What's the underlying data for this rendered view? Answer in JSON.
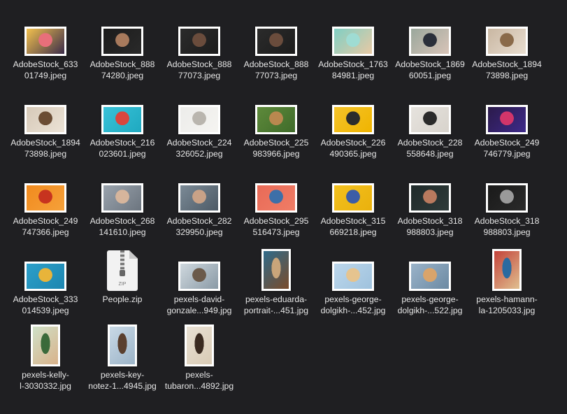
{
  "files": [
    {
      "l1": "AdobeStock_633",
      "l2": "01749.jpeg",
      "o": "land",
      "c": [
        "#f2c14e",
        "#e86f7a",
        "#3b2c4a"
      ]
    },
    {
      "l1": "AdobeStock_888",
      "l2": "74280.jpeg",
      "o": "land",
      "c": [
        "#1b1b1b",
        "#a87a5c",
        "#2a2a2a"
      ]
    },
    {
      "l1": "AdobeStock_888",
      "l2": "77073.jpeg",
      "o": "land",
      "c": [
        "#2b2b2b",
        "#6a4c3c",
        "#1c1c1c"
      ]
    },
    {
      "l1": "AdobeStock_888",
      "l2": "77073.jpeg",
      "o": "land",
      "c": [
        "#2b2b2b",
        "#6a4c3c",
        "#1c1c1c"
      ]
    },
    {
      "l1": "AdobeStock_1763",
      "l2": "84981.jpeg",
      "o": "land",
      "c": [
        "#7fcfc4",
        "#9fdcd3",
        "#e8c9a4"
      ]
    },
    {
      "l1": "AdobeStock_1869",
      "l2": "60051.jpeg",
      "o": "land",
      "c": [
        "#9aa79c",
        "#2a2f3a",
        "#d8c4b8"
      ]
    },
    {
      "l1": "AdobeStock_1894",
      "l2": "73898.jpeg",
      "o": "land",
      "c": [
        "#c9b7a2",
        "#8a6a4a",
        "#e8ddd0"
      ]
    },
    {
      "l1": "AdobeStock_1894",
      "l2": "73898.jpeg",
      "o": "land",
      "c": [
        "#d6c9b8",
        "#6b4d34",
        "#ece3d6"
      ]
    },
    {
      "l1": "AdobeStock_216",
      "l2": "023601.jpeg",
      "o": "land",
      "c": [
        "#39c2d8",
        "#d9463e",
        "#1fa9c0"
      ]
    },
    {
      "l1": "AdobeStock_224",
      "l2": "326052.jpeg",
      "o": "land",
      "c": [
        "#ececea",
        "#b9b5ae",
        "#f5f4f1"
      ]
    },
    {
      "l1": "AdobeStock_225",
      "l2": "983966.jpeg",
      "o": "land",
      "c": [
        "#5e8a3b",
        "#b9884f",
        "#3f6b2a"
      ]
    },
    {
      "l1": "AdobeStock_226",
      "l2": "490365.jpeg",
      "o": "land",
      "c": [
        "#f4c32a",
        "#2c2c2c",
        "#f0b400"
      ]
    },
    {
      "l1": "AdobeStock_228",
      "l2": "558648.jpeg",
      "o": "land",
      "c": [
        "#e6e3de",
        "#2a2a2a",
        "#d8d3cc"
      ]
    },
    {
      "l1": "AdobeStock_249",
      "l2": "746779.jpeg",
      "o": "land",
      "c": [
        "#2b1a4a",
        "#d2356a",
        "#3e2a8a"
      ]
    },
    {
      "l1": "AdobeStock_249",
      "l2": "747366.jpeg",
      "o": "land",
      "c": [
        "#f18a1e",
        "#c7331f",
        "#f5a13a"
      ]
    },
    {
      "l1": "AdobeStock_268",
      "l2": "141610.jpeg",
      "o": "land",
      "c": [
        "#9aa3ad",
        "#d6b59c",
        "#6c757f"
      ]
    },
    {
      "l1": "AdobeStock_282",
      "l2": "329950.jpeg",
      "o": "land",
      "c": [
        "#7b8a96",
        "#c9a287",
        "#4d5a66"
      ]
    },
    {
      "l1": "AdobeStock_295",
      "l2": "516473.jpeg",
      "o": "land",
      "c": [
        "#e86a57",
        "#3d6fa8",
        "#f07d66"
      ]
    },
    {
      "l1": "AdobeStock_315",
      "l2": "669218.jpeg",
      "o": "land",
      "c": [
        "#f2c01e",
        "#3c5da6",
        "#eab10d"
      ]
    },
    {
      "l1": "AdobeStock_318",
      "l2": "988803.jpeg",
      "o": "land",
      "c": [
        "#1f2a2a",
        "#b97a5e",
        "#2f3b3a"
      ]
    },
    {
      "l1": "AdobeStock_318",
      "l2": "988803.jpeg",
      "o": "land",
      "c": [
        "#1a1a1a",
        "#9a9a9a",
        "#2a2a2a"
      ]
    },
    {
      "l1": "AdobeStock_333",
      "l2": "014539.jpeg",
      "o": "land",
      "c": [
        "#2c9fc9",
        "#e8b43a",
        "#1d86b0"
      ]
    },
    {
      "l1": "People.zip",
      "l2": "",
      "o": "zip",
      "c": []
    },
    {
      "l1": "pexels-david-",
      "l2": "gonzale...949.jpg",
      "o": "land",
      "c": [
        "#cfd8de",
        "#6b5a4a",
        "#8a9aa6"
      ]
    },
    {
      "l1": "pexels-eduarda-",
      "l2": "portrait-...451.jpg",
      "o": "port",
      "c": [
        "#2f6b8a",
        "#c9a57a",
        "#7a4b2a"
      ]
    },
    {
      "l1": "pexels-george-",
      "l2": "dolgikh-...452.jpg",
      "o": "land",
      "c": [
        "#bcd7ec",
        "#e6c48f",
        "#9fc2dd"
      ]
    },
    {
      "l1": "pexels-george-",
      "l2": "dolgikh-...522.jpg",
      "o": "land",
      "c": [
        "#9ab3c9",
        "#d9a46b",
        "#6c8aa3"
      ]
    },
    {
      "l1": "pexels-hamann-",
      "l2": "la-1205033.jpg",
      "o": "port",
      "c": [
        "#c3423a",
        "#2a6aa0",
        "#e0c090"
      ]
    },
    {
      "l1": "pexels-kelly-",
      "l2": "l-3030332.jpg",
      "o": "port",
      "c": [
        "#cfe1c8",
        "#3a6a3a",
        "#d9b28a"
      ]
    },
    {
      "l1": "pexels-key-",
      "l2": "notez-1...4945.jpg",
      "o": "port",
      "c": [
        "#c9d9e6",
        "#5a3f2e",
        "#9cb4c8"
      ]
    },
    {
      "l1": "pexels-",
      "l2": "tubaron...4892.jpg",
      "o": "port",
      "c": [
        "#e9e1d4",
        "#3a2a20",
        "#d9cbb5"
      ]
    }
  ]
}
